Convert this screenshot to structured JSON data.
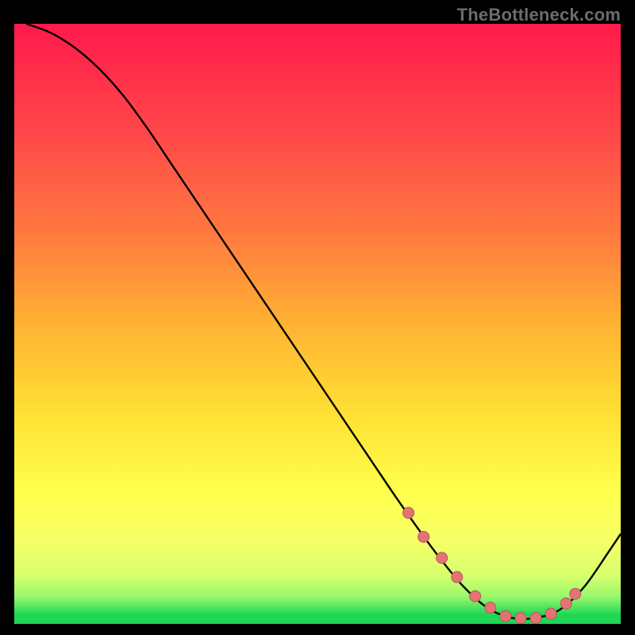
{
  "watermark_text": "TheBottleneck.com",
  "colors": {
    "black": "#000000",
    "watermark": "#6c6c6c",
    "curve": "#000000",
    "dot_fill": "#e57373",
    "dot_stroke": "#b35a5a",
    "green_band": "#1fd655"
  },
  "gradient_stops": [
    {
      "offset": 0.0,
      "color": "#ff1a4b"
    },
    {
      "offset": 0.18,
      "color": "#ff474a"
    },
    {
      "offset": 0.35,
      "color": "#ff7a3f"
    },
    {
      "offset": 0.5,
      "color": "#ffb233"
    },
    {
      "offset": 0.65,
      "color": "#ffe033"
    },
    {
      "offset": 0.78,
      "color": "#ffff4d"
    },
    {
      "offset": 0.86,
      "color": "#f7ff66"
    },
    {
      "offset": 0.92,
      "color": "#d6ff6e"
    },
    {
      "offset": 0.955,
      "color": "#97f96b"
    },
    {
      "offset": 0.985,
      "color": "#1fd655"
    }
  ],
  "chart_data": {
    "type": "line",
    "title": "",
    "xlabel": "",
    "ylabel": "",
    "xlim": [
      0,
      100
    ],
    "ylim": [
      0,
      100
    ],
    "series": [
      {
        "name": "bottleneck-curve",
        "x": [
          2,
          6,
          10,
          14,
          18,
          22,
          26,
          30,
          34,
          38,
          42,
          46,
          50,
          54,
          58,
          62,
          66,
          70,
          74,
          78,
          82,
          86,
          90,
          94,
          98,
          100
        ],
        "y": [
          100,
          98.5,
          96,
          92.5,
          88,
          82.5,
          76.5,
          70.5,
          64.5,
          58.5,
          52.5,
          46.5,
          40.5,
          34.5,
          28.5,
          22.5,
          16.7,
          11.2,
          6.3,
          2.7,
          1.0,
          1.0,
          2.4,
          6.2,
          12.0,
          15.0
        ]
      }
    ],
    "scatter": {
      "name": "highlighted-points",
      "x": [
        65,
        67.5,
        70.5,
        73,
        76,
        78.5,
        81,
        83.5,
        86,
        88.5,
        91,
        92.5
      ],
      "y": [
        18.5,
        14.5,
        11.0,
        7.8,
        4.6,
        2.7,
        1.3,
        1.0,
        1.0,
        1.7,
        3.4,
        5.0
      ]
    },
    "annotations": []
  }
}
